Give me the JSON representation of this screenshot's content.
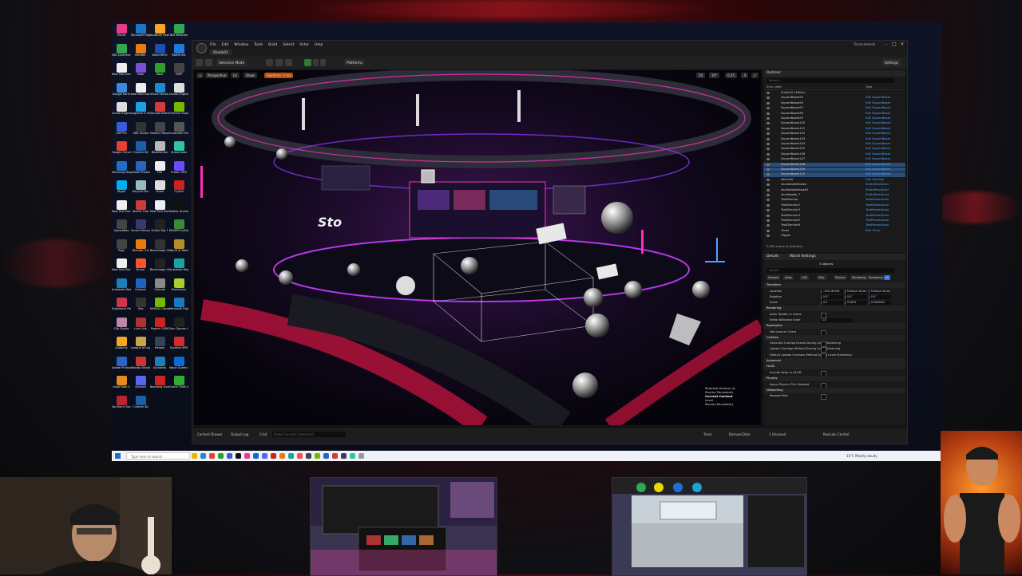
{
  "desktop": {
    "icons": [
      {
        "label": "iTunes",
        "color": "#e83a8a"
      },
      {
        "label": "Microsoft Flight Si...",
        "color": "#1a78c2"
      },
      {
        "label": "Audacity Reply",
        "color": "#f5a623"
      },
      {
        "label": "NDI Webcam",
        "color": "#2fa84f"
      },
      {
        "label": "NDI Launcher",
        "color": "#2fa84f"
      },
      {
        "label": "Blender",
        "color": "#e87d0d"
      },
      {
        "label": "Warcraft III",
        "color": "#1e4fb0"
      },
      {
        "label": "Battle.net",
        "color": "#1f7ae0"
      },
      {
        "label": "New Text Docume...",
        "color": "#eeeeee"
      },
      {
        "label": "Viber",
        "color": "#7b4fd6"
      },
      {
        "label": "Xbox",
        "color": "#2e9e2e"
      },
      {
        "label": "ICMP",
        "color": "#444444"
      },
      {
        "label": "Google Earth",
        "color": "#3b8ad9"
      },
      {
        "label": "New Text Docume...",
        "color": "#eeeeee"
      },
      {
        "label": "Visual Studio Code",
        "color": "#1f8ad2"
      },
      {
        "label": "Unreal Engine",
        "color": "#dddddd"
      },
      {
        "label": "Unreal Engine",
        "color": "#dddddd"
      },
      {
        "label": "Logitech G HUB",
        "color": "#1fa0e0"
      },
      {
        "label": "Sample Batch Script",
        "color": "#d33c3c"
      },
      {
        "label": "GeForce Experience",
        "color": "#76b900"
      },
      {
        "label": "VSP Pro",
        "color": "#3b5bd6"
      },
      {
        "label": "OBS Studio",
        "color": "#333333"
      },
      {
        "label": "DaVinci Resolve",
        "color": "#444444"
      },
      {
        "label": "Controller Editor",
        "color": "#555555"
      },
      {
        "label": "Google Chrome",
        "color": "#e34133"
      },
      {
        "label": "Cinema 4D",
        "color": "#1c5fa8"
      },
      {
        "label": "Bitdefender",
        "color": "#b8b8b8"
      },
      {
        "label": "Streamlabs",
        "color": "#31c3a2"
      },
      {
        "label": "Samsung Magician",
        "color": "#1f6fc4"
      },
      {
        "label": "Adobe Photoshop",
        "color": "#2b63c2"
      },
      {
        "label": "File",
        "color": "#eeeeee"
      },
      {
        "label": "Proton VPN",
        "color": "#6d4aff"
      },
      {
        "label": "Skype",
        "color": "#00aff0"
      },
      {
        "label": "Recycle Bin",
        "color": "#9bb"
      },
      {
        "label": "Video",
        "color": "#ddd"
      },
      {
        "label": "Crytek",
        "color": "#c22"
      },
      {
        "label": "New Text Docume...",
        "color": "#eeeeee"
      },
      {
        "label": "Atomic Hub",
        "color": "#d23a3a"
      },
      {
        "label": "New Text Docume...",
        "color": "#eeeeee"
      },
      {
        "label": "Native Access",
        "color": "#111111"
      },
      {
        "label": "SquareBox",
        "color": "#444444"
      },
      {
        "label": "Screen Recorder",
        "color": "#3a3a6a"
      },
      {
        "label": "Guitar Rig 7",
        "color": "#222222"
      },
      {
        "label": "REAPER (x64)",
        "color": "#3a8a3a"
      },
      {
        "label": "Rigs",
        "color": "#444"
      },
      {
        "label": "Blender 3.6",
        "color": "#e87d0d"
      },
      {
        "label": "Blackmagic RAW",
        "color": "#333"
      },
      {
        "label": "World of Warcraft",
        "color": "#b58c2a"
      },
      {
        "label": "New Text Docume...",
        "color": "#eeeeee"
      },
      {
        "label": "Brave",
        "color": "#fb542b"
      },
      {
        "label": "Blackmagic Design",
        "color": "#222"
      },
      {
        "label": "Autodesk Maya",
        "color": "#1aa3a3"
      },
      {
        "label": "Autodesk Max",
        "color": "#1d7fb8"
      },
      {
        "label": "Outlook",
        "color": "#2061c6"
      },
      {
        "label": "Outcast",
        "color": "#8a8a8a"
      },
      {
        "label": "Reallusion",
        "color": "#a8d12c"
      },
      {
        "label": "Substance Painter",
        "color": "#c8384a"
      },
      {
        "label": "Obs",
        "color": "#333"
      },
      {
        "label": "NVIDIA Canvas",
        "color": "#76b900"
      },
      {
        "label": "Microsoft Flight Si...",
        "color": "#1a78c2"
      },
      {
        "label": "Clip Studio",
        "color": "#b8a"
      },
      {
        "label": "Live Link",
        "color": "#a33"
      },
      {
        "label": "Project CARS",
        "color": "#c22"
      },
      {
        "label": "Epic Games Launcher",
        "color": "#222"
      },
      {
        "label": "Audacity",
        "color": "#f5a623"
      },
      {
        "label": "League of Legends",
        "color": "#c9a44a"
      },
      {
        "label": "Heroes",
        "color": "#345"
      },
      {
        "label": "Express VPN",
        "color": "#d32a2a"
      },
      {
        "label": "Adobe Photoshop",
        "color": "#2b63c2"
      },
      {
        "label": "Rokoko Studio",
        "color": "#c33"
      },
      {
        "label": "Autodesk",
        "color": "#1d7fb8"
      },
      {
        "label": "Wave Queen Link",
        "color": "#0a6ad8"
      },
      {
        "label": "AmpliTube 5",
        "color": "#e48b1f"
      },
      {
        "label": "Discord",
        "color": "#5865f2"
      },
      {
        "label": "Boinkerg Overview",
        "color": "#c22"
      },
      {
        "label": "Grand Theft Auto V",
        "color": "#3a3"
      },
      {
        "label": "No Man's Sky",
        "color": "#b23"
      },
      {
        "label": "Cinema 4D",
        "color": "#1c5fa8"
      }
    ]
  },
  "editor": {
    "window_title": "Tournament",
    "menus": [
      "File",
      "Edit",
      "Window",
      "Tools",
      "Build",
      "Select",
      "Actor",
      "Help"
    ],
    "tab_label": "Studio01",
    "toolbar": {
      "mode": "Selection Mode",
      "platforms": "Platforms",
      "settings": "Settings"
    },
    "viewport": {
      "perspective": "Perspective",
      "lit": "Lit",
      "show": "Show",
      "realtime_label": "Realtime: 3 ms",
      "overlay_lines": [
        "Selected Actor(s) in:",
        "Studio (Persistent)",
        "Current Context",
        "Level",
        "Studio (Persistent)"
      ],
      "grid_value": "10",
      "angle_value": "10°",
      "scale_value": "0.25",
      "camera_speed": "4"
    },
    "outliner": {
      "title": "Outliner",
      "search_placeholder": "Search...",
      "col_item": "Item Label",
      "col_type": "Type",
      "rows": [
        {
          "name": "Studio01 (Editor)",
          "type": "",
          "sel": false
        },
        {
          "name": "SquareBoxes95",
          "type": "Edit SquareBoxes",
          "sel": false
        },
        {
          "name": "SquareBoxes96",
          "type": "Edit SquareBoxes",
          "sel": false
        },
        {
          "name": "SquareBoxes97",
          "type": "Edit SquareBoxes",
          "sel": false
        },
        {
          "name": "SquareBoxes98",
          "type": "Edit SquareBoxes",
          "sel": false
        },
        {
          "name": "SquareBoxes99",
          "type": "Edit SquareBoxes",
          "sel": false
        },
        {
          "name": "SquareBoxes100",
          "type": "Edit SquareBoxes",
          "sel": false
        },
        {
          "name": "SquareBoxes101",
          "type": "Edit SquareBoxes",
          "sel": false
        },
        {
          "name": "SquareBoxes102",
          "type": "Edit SquareBoxes",
          "sel": false
        },
        {
          "name": "SquareBoxes103",
          "type": "Edit SquareBoxes",
          "sel": false
        },
        {
          "name": "SquareBoxes104",
          "type": "Edit SquareBoxes",
          "sel": false
        },
        {
          "name": "SquareBoxes105",
          "type": "Edit SquareBoxes",
          "sel": false
        },
        {
          "name": "SquareBoxes106",
          "type": "Edit SquareBoxes",
          "sel": false
        },
        {
          "name": "SquareBoxes107",
          "type": "Edit SquareBoxes",
          "sel": false
        },
        {
          "name": "SquareBoxes108",
          "type": "Edit SquareBoxes",
          "sel": true
        },
        {
          "name": "SquareBoxes109",
          "type": "Edit SquareBoxes",
          "sel": true
        },
        {
          "name": "SquareBoxes110",
          "type": "Edit SquareBoxes",
          "sel": true
        },
        {
          "name": "sitechair",
          "type": "Edit sitechair",
          "sel": false
        },
        {
          "name": "studiotableRaised",
          "type": "StaticMeshActor",
          "sel": false
        },
        {
          "name": "studiotableRaised2",
          "type": "StaticMeshActor",
          "sel": false
        },
        {
          "name": "studiotable_7",
          "type": "StaticMeshActor",
          "sel": false
        },
        {
          "name": "TextDirector",
          "type": "TextRenderActor",
          "sel": false
        },
        {
          "name": "TextDirector2",
          "type": "TextRenderActor",
          "sel": false
        },
        {
          "name": "TextDirector3",
          "type": "TextRenderActor",
          "sel": false
        },
        {
          "name": "TextDirector4",
          "type": "TextRenderActor",
          "sel": false
        },
        {
          "name": "TextDirector5",
          "type": "TextRenderActor",
          "sel": false
        },
        {
          "name": "TextDirector6",
          "type": "TextRenderActor",
          "sel": false
        },
        {
          "name": "Timer",
          "type": "Edit Timer",
          "sel": false
        },
        {
          "name": "Trigger",
          "type": "",
          "sel": false
        }
      ],
      "footer": "2,903 actors (3 selected)"
    },
    "details": {
      "tab_details": "Details",
      "tab_world": "World Settings",
      "objects": "3 objects",
      "search_placeholder": "Search",
      "filters": [
        "General",
        "Actor",
        "LOD",
        "Misc",
        "Physics",
        "Rendering",
        "Streaming",
        "All"
      ],
      "sections": [
        {
          "title": "Transform",
          "rows": [
            "Location",
            "Rotation",
            "Scale"
          ]
        },
        {
          "title": "Rendering",
          "rows": [
            "Actor Hidden In Game",
            "Editor Billboard Scale"
          ]
        },
        {
          "title": "Replication",
          "rows": [
            "Net Load on Client"
          ]
        },
        {
          "title": "Collision",
          "rows": [
            "Generate Overlap Events During Level Streaming",
            "Update Overlaps Method During Level Streaming",
            "Default Update Overlaps Method During Level Streaming"
          ]
        },
        {
          "title": "Advanced",
          "rows": []
        },
        {
          "title": "HLOD",
          "rows": [
            "Include Actor in HLOD"
          ]
        },
        {
          "title": "Physics",
          "rows": [
            "Async Physics Tick Enabled"
          ]
        },
        {
          "title": "Networking",
          "rows": [
            "Remote Role"
          ]
        }
      ],
      "location": [
        "-1052.60596",
        "Multiple Values",
        "Multiple Values"
      ],
      "rotation": [
        "0.0°",
        "0.0°",
        "0.0°"
      ],
      "scale": [
        "0.5",
        "0.5875",
        "0.5000000"
      ],
      "billboard": "1.0"
    },
    "statusbar": {
      "content_drawer": "Content Drawer",
      "output_log": "Output Log",
      "cmd": "Cmd",
      "cmd_placeholder": "Enter Console Command",
      "trace": "Trace",
      "derived": "Derived Data",
      "unsaved": "1 Unsaved",
      "revision": "Revision Control"
    }
  },
  "taskbar": {
    "search_placeholder": "Type here to search",
    "weather": "15°C Mostly cloudy",
    "icon_colors": [
      "#f0b400",
      "#1f8ad2",
      "#e34133",
      "#2e9e2e",
      "#3b5bd6",
      "#111111",
      "#e83a8a",
      "#0a6ad8",
      "#5865f2",
      "#c22",
      "#e87d0d",
      "#1aa3a3",
      "#ff4b4b",
      "#444",
      "#76b900",
      "#2b63c2",
      "#d33c3c",
      "#3a3a6a",
      "#31c3a2",
      "#999"
    ]
  },
  "colors": {
    "accent_blue": "#4ea3ff",
    "selection": "#2a4d7a",
    "neon_pink": "#ff2fb3",
    "neon_purple": "#8d3dff"
  }
}
